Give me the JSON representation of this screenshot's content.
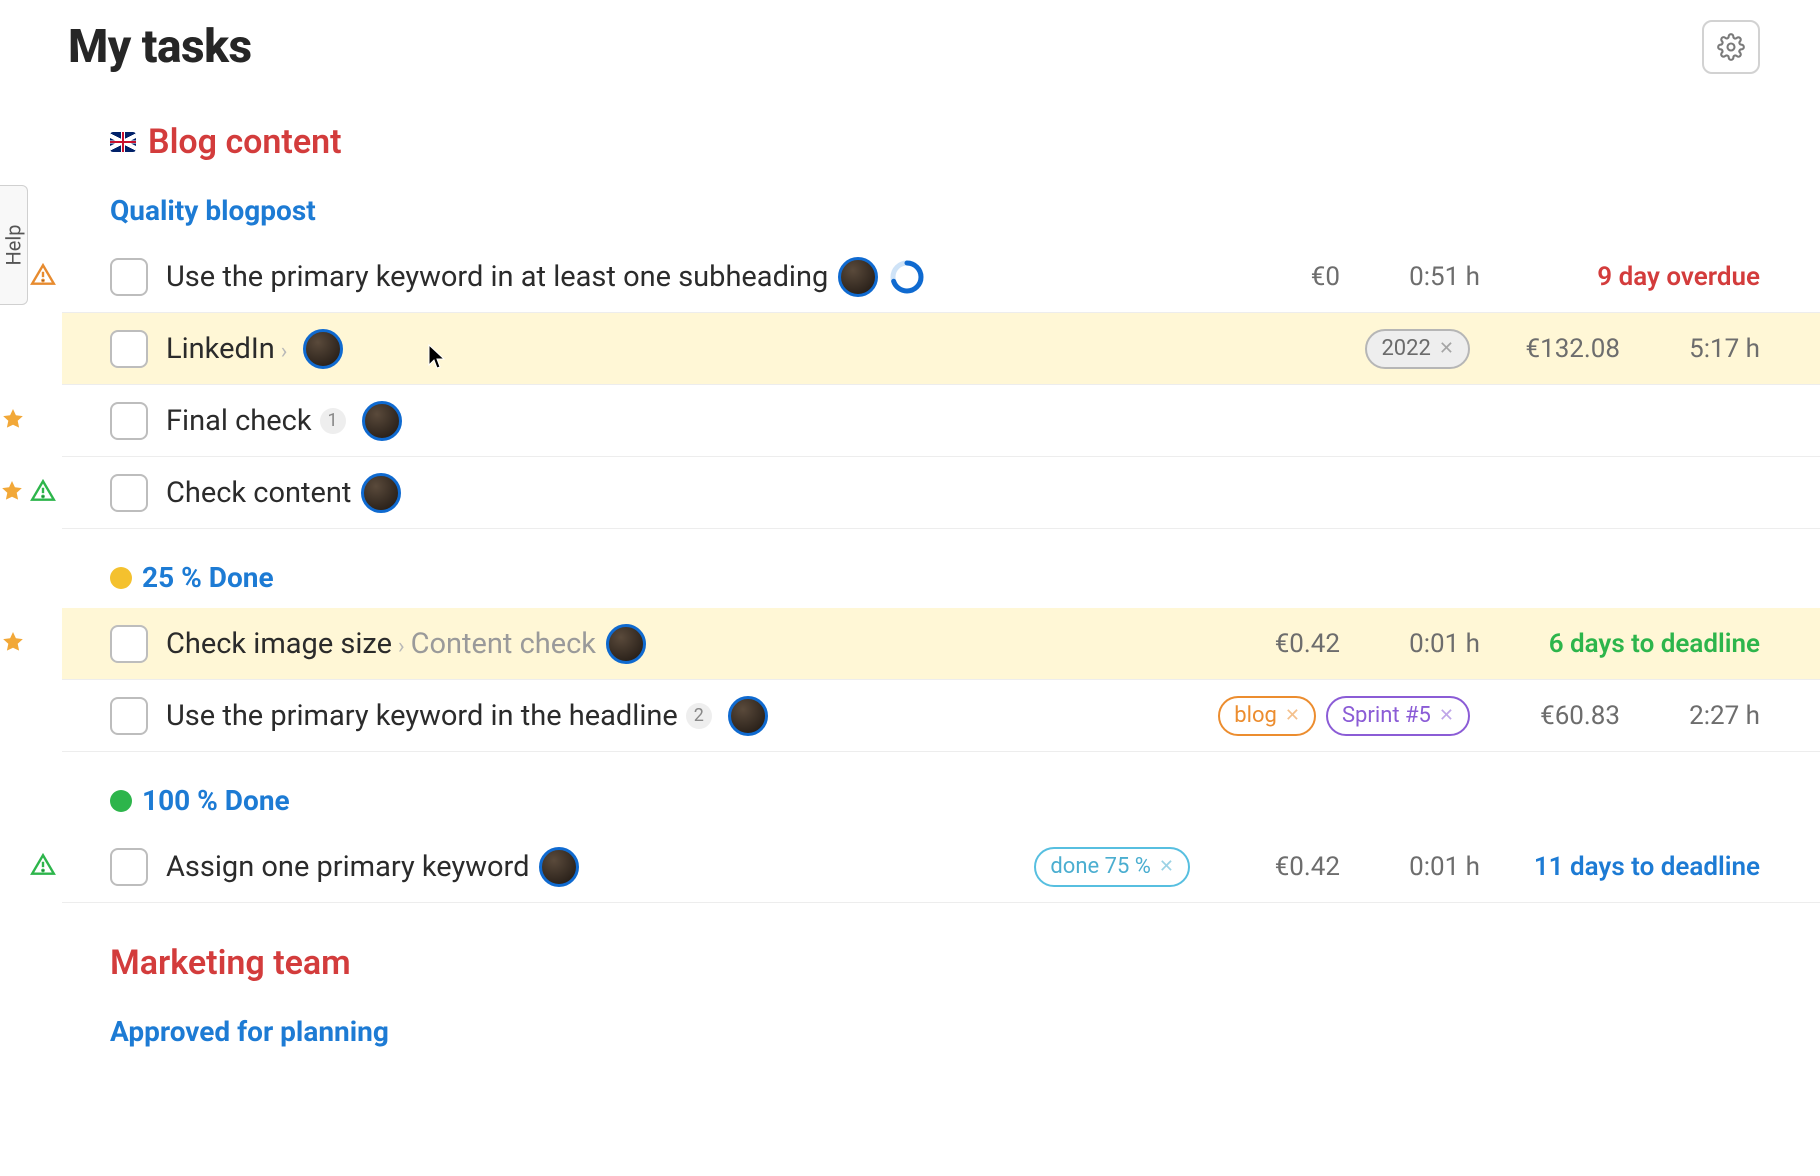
{
  "help_label": "Help",
  "page_title": "My tasks",
  "project": {
    "flag": "uk",
    "title": "Blog content"
  },
  "sections": [
    {
      "title": "Quality blogpost",
      "type": "plain",
      "tasks": [
        {
          "star": false,
          "warn": "orange",
          "highlight": false,
          "name": "Use the primary keyword in at least one subheading",
          "sub": null,
          "count": null,
          "avatar": true,
          "progress": 70,
          "tags": [],
          "cost": "€0",
          "time": "0:51 h",
          "due": "9 day overdue",
          "due_class": "due-red",
          "cursor": false
        },
        {
          "star": false,
          "warn": null,
          "highlight": true,
          "name": "LinkedIn",
          "chev": true,
          "sub": null,
          "count": null,
          "avatar": true,
          "progress": null,
          "tags": [
            {
              "text": "2022",
              "cls": "gray"
            }
          ],
          "cost": "€132.08",
          "time": "5:17 h",
          "due": null,
          "due_class": "",
          "cursor": true
        },
        {
          "star": true,
          "warn": null,
          "highlight": false,
          "name": "Final check",
          "sub": null,
          "count": "1",
          "avatar": true,
          "progress": null,
          "tags": [],
          "cost": null,
          "time": null,
          "due": null,
          "due_class": ""
        },
        {
          "star": true,
          "warn": "green",
          "highlight": false,
          "name": "Check content",
          "sub": null,
          "count": null,
          "avatar": true,
          "progress": null,
          "tags": [],
          "cost": null,
          "time": null,
          "due": null,
          "due_class": ""
        }
      ]
    },
    {
      "title": "25 % Done",
      "type": "dot-yellow",
      "tasks": [
        {
          "star": true,
          "warn": null,
          "highlight": true,
          "name": "Check image size",
          "chev": true,
          "sub": "Content check",
          "count": null,
          "avatar": true,
          "progress": null,
          "tags": [],
          "cost": "€0.42",
          "time": "0:01 h",
          "due": "6 days to deadline",
          "due_class": "due-green"
        },
        {
          "star": false,
          "warn": null,
          "highlight": false,
          "name": "Use the primary keyword in the headline",
          "sub": null,
          "count": "2",
          "avatar": true,
          "progress": null,
          "tags": [
            {
              "text": "blog",
              "cls": "orange"
            },
            {
              "text": "Sprint #5",
              "cls": "purple"
            }
          ],
          "cost": "€60.83",
          "time": "2:27 h",
          "due": null,
          "due_class": ""
        }
      ]
    },
    {
      "title": "100 % Done",
      "type": "dot-green",
      "tasks": [
        {
          "star": false,
          "warn": "green",
          "highlight": false,
          "name": "Assign one primary keyword",
          "sub": null,
          "count": null,
          "avatar": true,
          "progress": null,
          "tags": [
            {
              "text": "done 75 %",
              "cls": "cyan"
            }
          ],
          "cost": "€0.42",
          "time": "0:01 h",
          "due": "11 days to deadline",
          "due_class": "due-blue"
        }
      ]
    }
  ],
  "project2": {
    "title": "Marketing team"
  },
  "section2_title": "Approved for planning"
}
